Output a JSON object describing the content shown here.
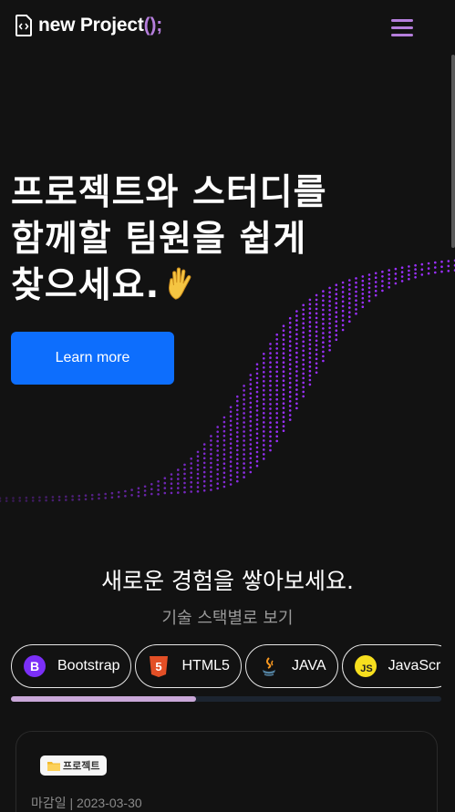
{
  "navbar": {
    "logo_main": "new Project",
    "logo_accent": "();",
    "menu_icon": "hamburger-menu-icon",
    "accent_color": "#b57edc"
  },
  "hero": {
    "title_lines": [
      "프로젝트와 스터디를",
      "함께할 팀원을 쉽게",
      "찾으세요."
    ],
    "emoji_icon": "waving-hand-icon",
    "button_label": "Learn more",
    "button_color": "#0d6efd",
    "wave_color": "#9b30ff"
  },
  "tech_section": {
    "title": "새로운 경험을 쌓아보세요.",
    "subtitle": "기술 스택별로 보기",
    "chips": [
      {
        "label": "Bootstrap",
        "icon": "bootstrap-icon"
      },
      {
        "label": "HTML5",
        "icon": "html5-icon"
      },
      {
        "label": "JAVA",
        "icon": "java-icon"
      },
      {
        "label": "JavaScri",
        "icon": "javascript-icon"
      }
    ],
    "scroll_progress": 0.43
  },
  "card": {
    "badge": "프로젝트",
    "badge_icon": "folder-icon",
    "deadline": "마감일 | 2023-03-30"
  }
}
